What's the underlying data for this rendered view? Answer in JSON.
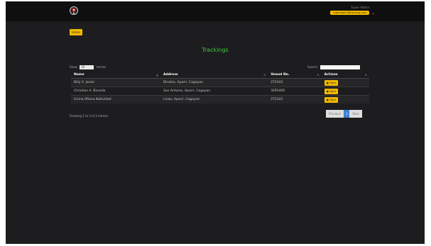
{
  "topbar": {
    "user_name": "Super Admin",
    "user_email": "superadmin@tracking.com"
  },
  "home_label": "Home",
  "page_title": "Trackings",
  "table_controls": {
    "show_label": "Show",
    "entries_value": "10",
    "entries_label": "entries",
    "search_label": "Search:",
    "search_value": ""
  },
  "table": {
    "headers": [
      "Name",
      "Address",
      "Vessel No.",
      "Actions"
    ],
    "rows": [
      {
        "name": "Billy S. Javier",
        "address": "Binalan, Aparri, Cagayan",
        "vessel": "272343",
        "action": "Track"
      },
      {
        "name": "Christian A. Bicarda",
        "address": "San Antonio, Aparri, Cagayan",
        "vessel": "3295495",
        "action": "Track"
      },
      {
        "name": "Girina Ofiana Natividad",
        "address": "Linao, Aparri, Cagayan",
        "vessel": "272343",
        "action": "Track"
      }
    ]
  },
  "info_text": "Showing 1 to 3 of 3 entries",
  "pagination": {
    "previous": "Previous",
    "current": "1",
    "next": "Next"
  },
  "colors": {
    "accent": "#f0b900",
    "title_green": "#3ccf3c",
    "background": "#1d1d1f",
    "topbar": "#0f0f10",
    "page_active": "#3b82d6"
  }
}
